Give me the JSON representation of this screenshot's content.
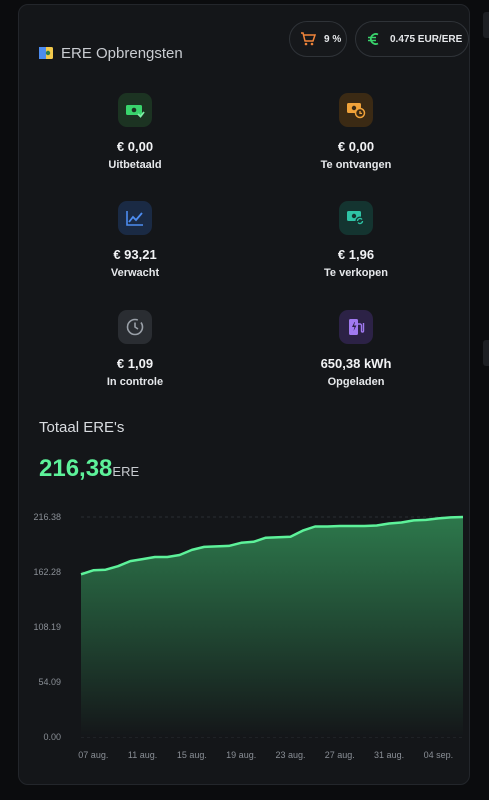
{
  "header": {
    "title": "ERE Opbrengsten"
  },
  "badges": {
    "percent": "9 %",
    "price": "0.475 EUR/ERE"
  },
  "stats": [
    {
      "value": "€ 0,00",
      "label": "Uitbetaald",
      "icon": "money-check-icon",
      "color": "#39d46c"
    },
    {
      "value": "€ 0,00",
      "label": "Te ontvangen",
      "icon": "money-clock-icon",
      "color": "#f0a23a"
    },
    {
      "value": "€ 93,21",
      "label": "Verwacht",
      "icon": "trend-chart-icon",
      "color": "#4d8cf0"
    },
    {
      "value": "€ 1,96",
      "label": "Te verkopen",
      "icon": "money-refresh-icon",
      "color": "#2ec4a6"
    },
    {
      "value": "€ 1,09",
      "label": "In controle",
      "icon": "clock-icon",
      "color": "#9aa0a8"
    },
    {
      "value": "650,38 kWh",
      "label": "Opgeladen",
      "icon": "ev-charger-icon",
      "color": "#a07af0"
    }
  ],
  "total": {
    "label": "Totaal ERE's",
    "value": "216,38",
    "unit": "ERE"
  },
  "chart_data": {
    "type": "area",
    "x": [
      "06 aug.",
      "07 aug.",
      "08 aug.",
      "09 aug.",
      "10 aug.",
      "11 aug.",
      "12 aug.",
      "13 aug.",
      "14 aug.",
      "15 aug.",
      "16 aug.",
      "17 aug.",
      "18 aug.",
      "19 aug.",
      "20 aug.",
      "21 aug.",
      "22 aug.",
      "23 aug.",
      "24 aug.",
      "25 aug.",
      "26 aug.",
      "27 aug.",
      "28 aug.",
      "29 aug.",
      "30 aug.",
      "31 aug.",
      "01 sep.",
      "02 sep.",
      "03 sep.",
      "04 sep.",
      "05 sep.",
      "06 sep."
    ],
    "x_tick_labels": [
      "07 aug.",
      "11 aug.",
      "15 aug.",
      "19 aug.",
      "23 aug.",
      "27 aug.",
      "31 aug.",
      "04 sep."
    ],
    "y_tick_labels": [
      "216.38",
      "162.28",
      "108.19",
      "54.09",
      "0.00"
    ],
    "ylim": [
      0,
      216.38
    ],
    "series": [
      {
        "values": [
          160,
          164,
          164.5,
          168,
          173,
          175,
          177,
          177,
          179,
          184,
          187,
          187.5,
          188,
          191,
          192,
          196,
          196.5,
          197,
          203,
          207,
          207,
          207.5,
          207.5,
          207.5,
          208,
          210,
          211,
          213,
          213.5,
          215,
          216,
          216.38
        ]
      }
    ],
    "colors": {
      "line": "#5df29a",
      "fill_top": "#2e7d4e",
      "fill_bottom": "#141619",
      "grid": "#2a2d32",
      "tick": "#8a8f96"
    },
    "grid": true
  }
}
